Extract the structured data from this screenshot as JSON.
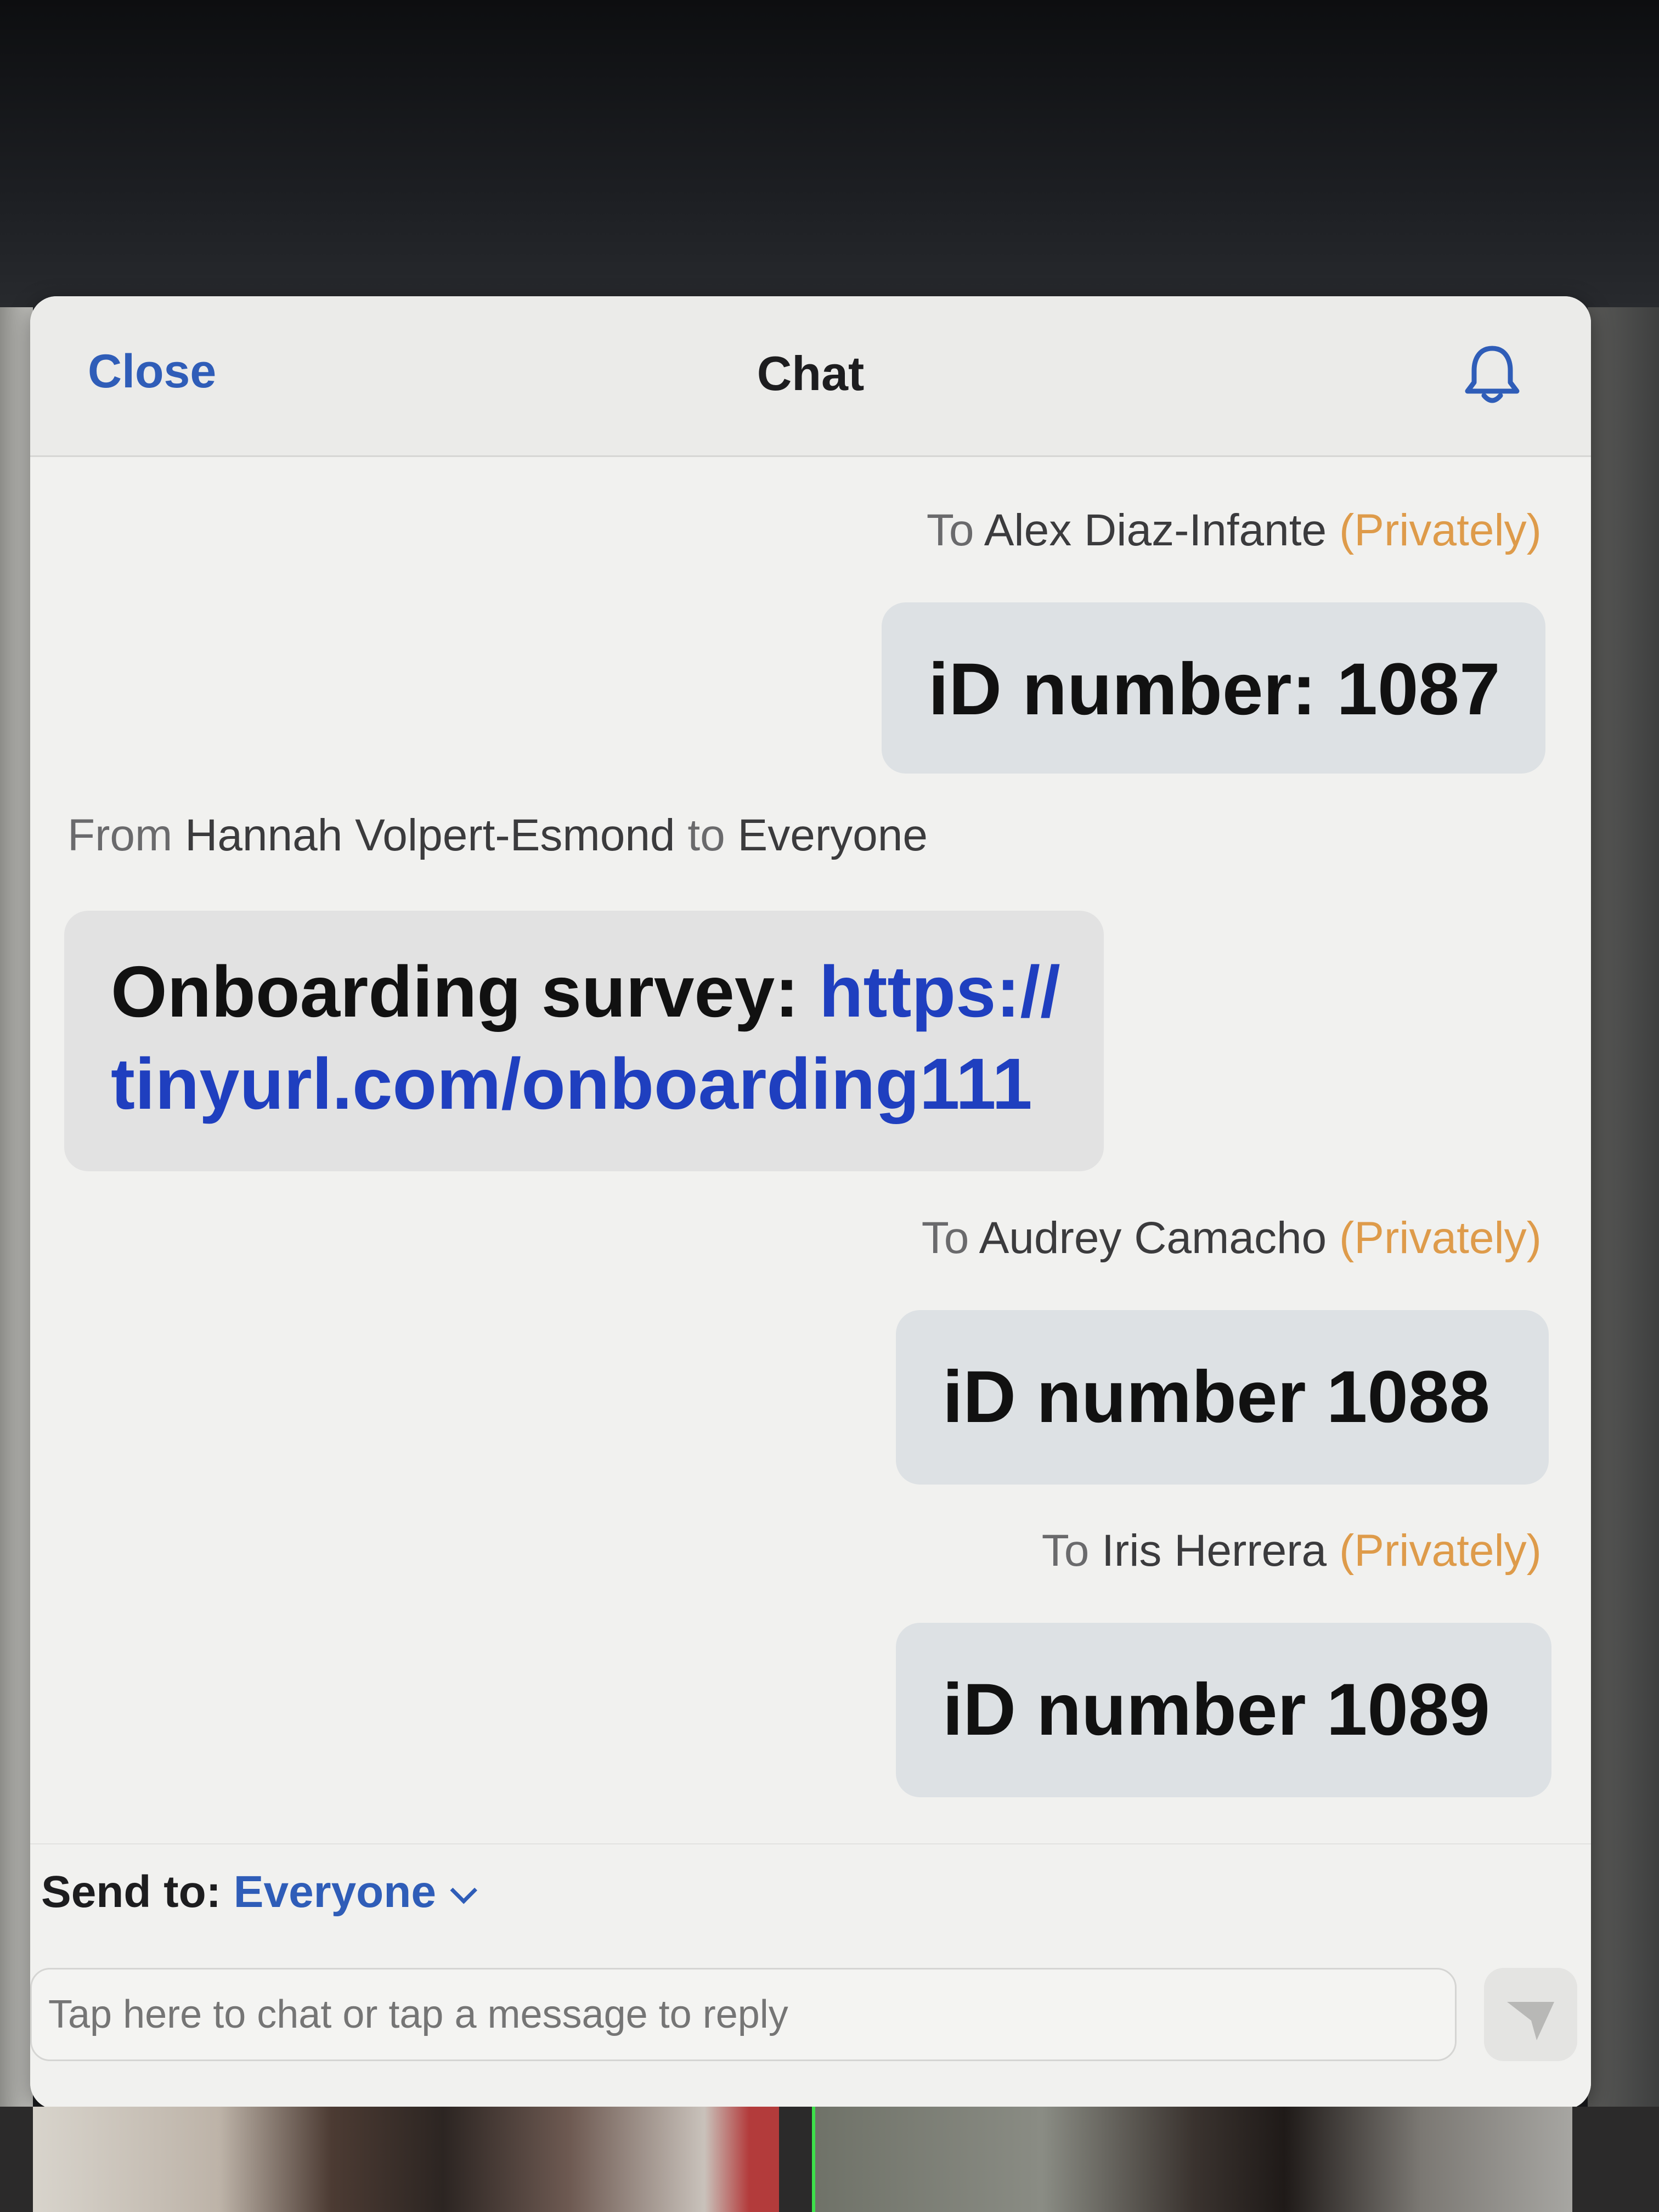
{
  "header": {
    "close_label": "Close",
    "title": "Chat",
    "notification_icon": "bell-icon"
  },
  "messages": [
    {
      "direction": "outgoing",
      "prefix": "To",
      "recipient": "Alex Diaz-Infante",
      "privacy": "(Privately)",
      "text": "iD number: 1087"
    },
    {
      "direction": "incoming",
      "prefix": "From",
      "sender": "Hannah Volpert-Esmond",
      "joiner": "to",
      "audience": "Everyone",
      "text_prefix": "Onboarding survey: ",
      "link_line1": "https://",
      "link_line2": "tinyurl.com/onboarding111"
    },
    {
      "direction": "outgoing",
      "prefix": "To",
      "recipient": "Audrey Camacho",
      "privacy": "(Privately)",
      "text": "iD number 1088"
    },
    {
      "direction": "outgoing",
      "prefix": "To",
      "recipient": "Iris Herrera",
      "privacy": "(Privately)",
      "text": "iD number 1089"
    }
  ],
  "footer": {
    "send_to_label": "Send to:",
    "send_to_value": "Everyone",
    "input_placeholder": "Tap here to chat or tap a message to reply",
    "send_icon": "send-icon"
  },
  "colors": {
    "accent": "#2f5db8",
    "privately": "#de9b4a",
    "link": "#1f3fbf",
    "bubble": "#dde1e4"
  }
}
